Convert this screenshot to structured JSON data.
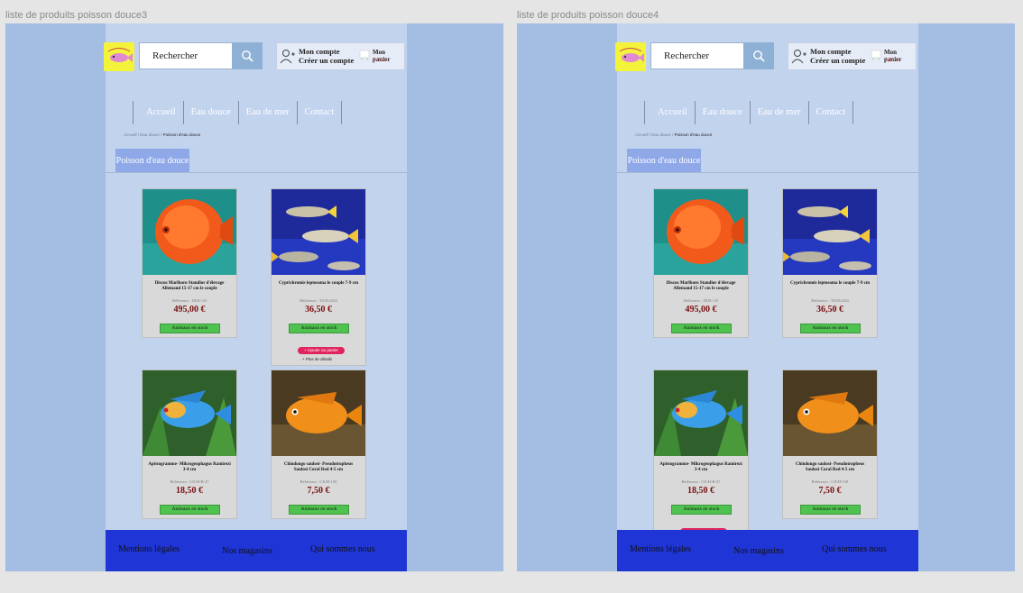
{
  "frames": [
    {
      "title": "liste de produits poisson douce3",
      "hovered_product": 1
    },
    {
      "title": "liste de produits poisson douce4",
      "hovered_product": 2
    }
  ],
  "header": {
    "search_placeholder": "Rechercher",
    "account_line1": "Mon compte",
    "account_line2": "Créer un compte",
    "cart_label": "Mon panier",
    "cart_price": "0,00 €"
  },
  "nav": [
    "Accueil",
    "Eau douce",
    "Eau de mer",
    "Contact"
  ],
  "breadcrumb": {
    "part1": "Accueil",
    "sep": " / ",
    "part2": "Eau douce",
    "current": "Poisson d'eau douce"
  },
  "category_tab": "Poisson d'eau douce",
  "products": [
    {
      "name": "Discus Marlboro Standlor d'élevage Allemand 15-17 cm le couple",
      "ref": "Référence : DISC-03",
      "price": "495,00 €",
      "stock": "Animaux en stock",
      "image": "discus-fish"
    },
    {
      "name": "Cyprichromis leptosoma le couple 7-9 cm",
      "ref": "Référence : TANGA04",
      "price": "36,50 €",
      "stock": "Animaux en stock",
      "image": "cyprichromis-fish"
    },
    {
      "name": "Apistogramme- Mikrogeophagus Ramirezi 3-4 cm",
      "ref": "Référence : CICH-R-27",
      "price": "18,50 €",
      "stock": "Animaux en stock",
      "image": "ramirezi-fish"
    },
    {
      "name": "Chindongo saulosi- Pseudotropheus Saulosi Coral Red 4-5 cm",
      "ref": "Référence : CICH-158",
      "price": "7,50 €",
      "stock": "Animaux en stock",
      "image": "chindongo-fish"
    }
  ],
  "hover_actions": {
    "add_to_cart": "+ Ajouter au panier",
    "details": "+ Plus de détails"
  },
  "footer": {
    "legal": "Mentions légales",
    "stores": "Nos magasins",
    "about": "Qui sommes nous"
  },
  "colors": {
    "canvas": "#e5e5e5",
    "frame_bg": "#a3bde3",
    "page_bg": "#c2d3ee",
    "footer_bg": "#1f35d6",
    "stock_green": "#4fc24f",
    "add_cart_pink": "#e0245e",
    "price_red": "#7a0f0f"
  }
}
